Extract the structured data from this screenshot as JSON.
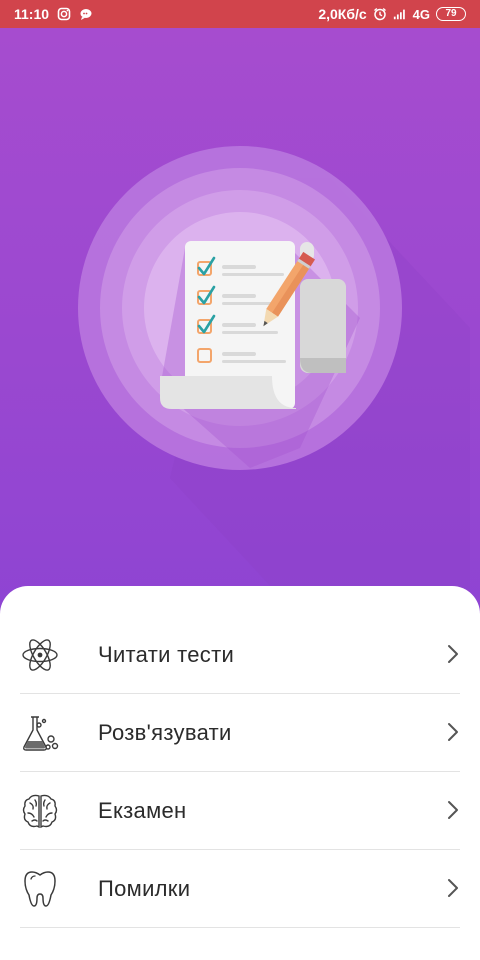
{
  "status_bar": {
    "time": "11:10",
    "net_speed": "2,0Кб/с",
    "net_type": "4G",
    "battery": "79",
    "icons": [
      "instagram-icon",
      "chat-bubble-icon",
      "alarm-icon",
      "signal-icon"
    ]
  },
  "hero": {
    "illustration": "checklist-with-pencil",
    "colors": {
      "gradient_top": "#a64ccf",
      "gradient_bottom": "#8e44d3",
      "check": "#2aa1a4",
      "pencil": "#f3a56b"
    }
  },
  "menu": {
    "items": [
      {
        "label": "Читати тести",
        "icon": "atom-icon"
      },
      {
        "label": "Розв'язувати",
        "icon": "lab-flask-icon"
      },
      {
        "label": "Екзамен",
        "icon": "brain-icon"
      },
      {
        "label": "Помилки",
        "icon": "tooth-icon"
      }
    ]
  }
}
